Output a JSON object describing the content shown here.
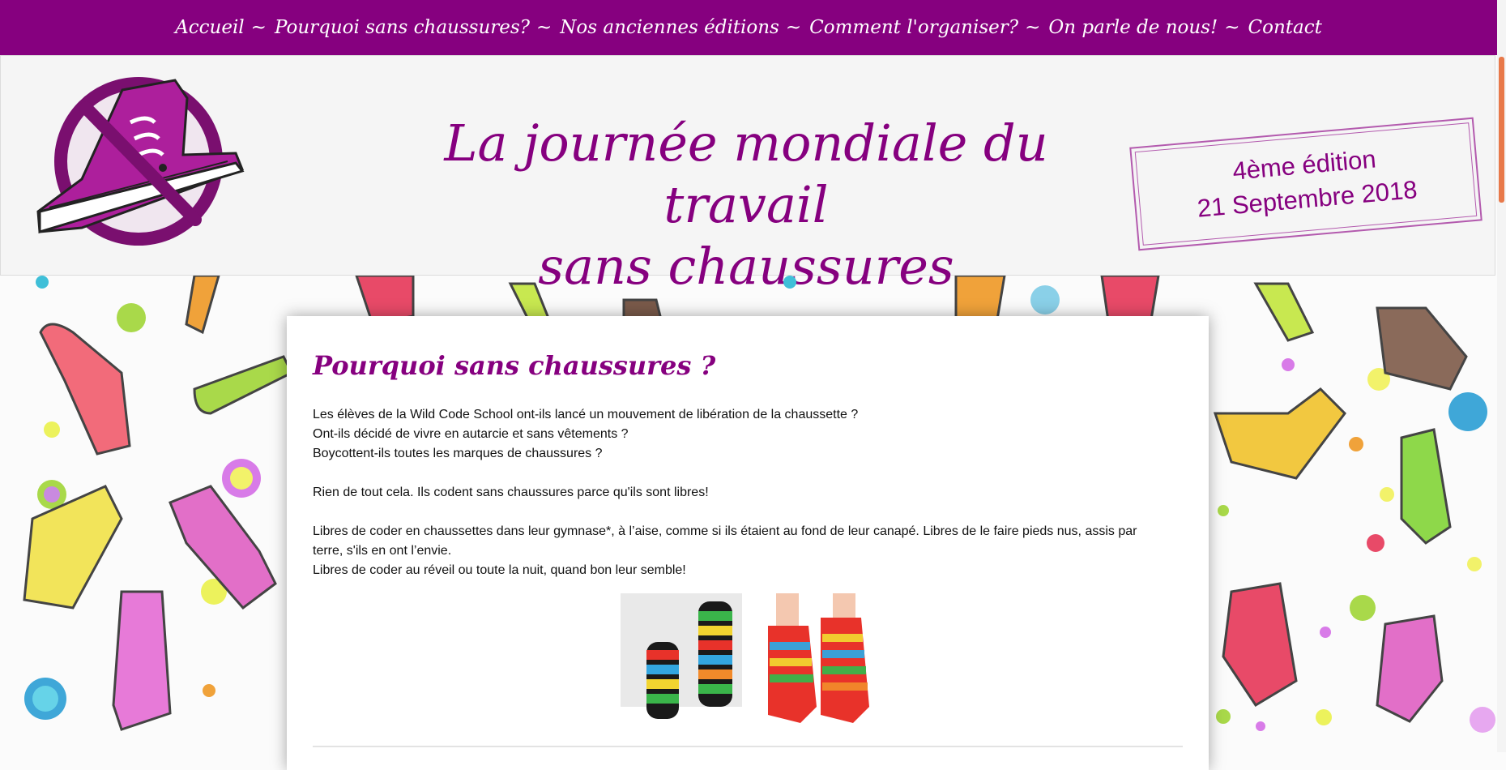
{
  "nav": {
    "items": [
      "Accueil",
      "Pourquoi sans chaussures?",
      "Nos anciennes éditions",
      "Comment l'organiser?",
      "On parle de nous!",
      "Contact"
    ],
    "separator": "~"
  },
  "header": {
    "title_line1": "La journée mondiale du travail",
    "title_line2": "sans chaussures",
    "stamp_line1": "4ème édition",
    "stamp_line2": "21 Septembre 2018"
  },
  "article": {
    "heading": "Pourquoi sans chaussures ?",
    "paragraphs": {
      "p1": "Les élèves de la Wild Code School ont-ils lancé un mouvement de libération de la chaussette ?",
      "p2": "Ont-ils décidé de vivre en autarcie et sans vêtements ?",
      "p3": "Boycottent-ils toutes les marques de chaussures ?",
      "p4": "Rien de tout cela. Ils codent sans chaussures parce qu'ils sont libres!",
      "p5": "Libres de coder en chaussettes dans leur gymnase*, à l’aise, comme si ils étaient au fond de leur canapé. Libres de le faire pieds nus, assis par terre, s'ils en ont l’envie.",
      "p6": "Libres de coder au réveil ou toute la nuit, quand bon leur semble!"
    }
  },
  "colors": {
    "brand_purple": "#86007f",
    "scroll_accent": "#e8794a"
  },
  "icons": {
    "logo": "no-shoes-logo-icon",
    "photo1": "striped-toe-socks-photo",
    "photo2": "colorful-toe-socks-photo"
  }
}
